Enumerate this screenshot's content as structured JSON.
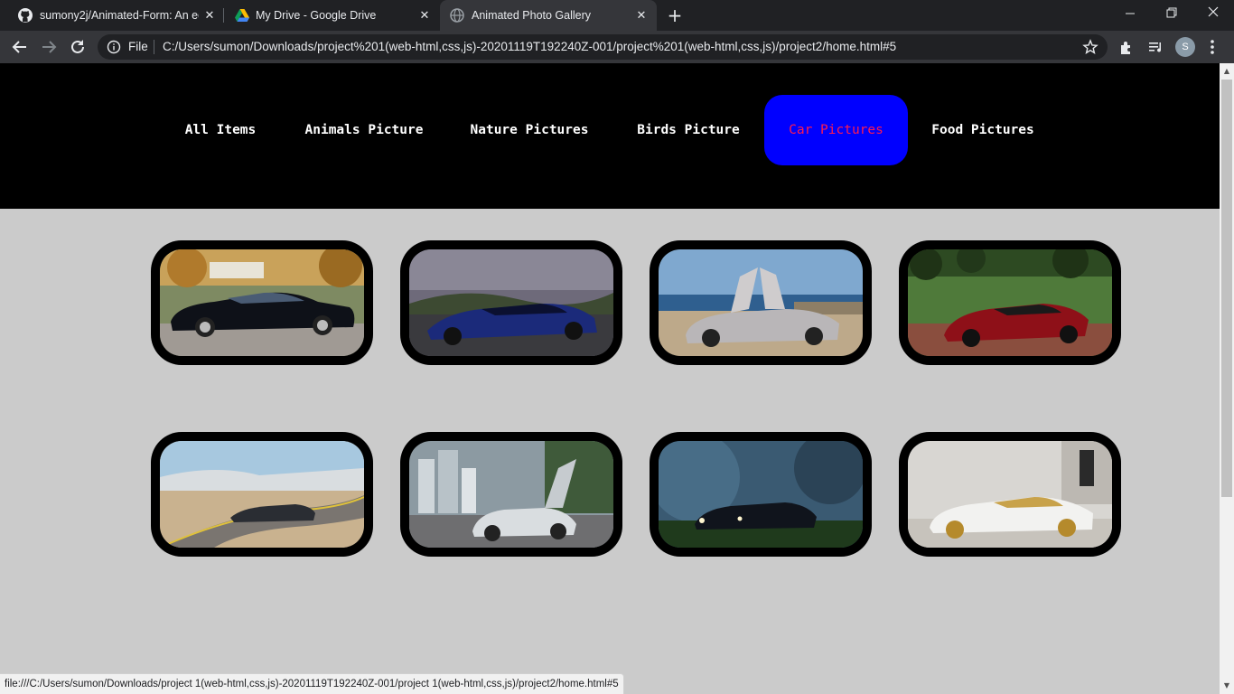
{
  "browser": {
    "tabs": [
      {
        "title": "sumony2j/Animated-Form: An ed",
        "close": "✕",
        "icon": "github-icon",
        "active": false
      },
      {
        "title": "My Drive - Google Drive",
        "close": "✕",
        "icon": "google-drive-icon",
        "active": false
      },
      {
        "title": "Animated Photo Gallery",
        "close": "✕",
        "icon": "globe-icon",
        "active": true
      }
    ],
    "new_tab": "+",
    "window_controls": {
      "minimize": "—",
      "restore": "❐",
      "close": "✕"
    },
    "omnibox": {
      "scheme_label": "File",
      "url": "C:/Users/sumon/Downloads/project%201(web-html,css,js)-20201119T192240Z-001/project%201(web-html,css,js)/project2/home.html#5"
    },
    "profile_initial": "S"
  },
  "gallery": {
    "nav": [
      {
        "label": "All Items",
        "active": false
      },
      {
        "label": "Animals Picture",
        "active": false
      },
      {
        "label": "Nature Pictures",
        "active": false
      },
      {
        "label": "Birds Picture",
        "active": false
      },
      {
        "label": "Car Pictures",
        "active": true
      },
      {
        "label": "Food Pictures",
        "active": false
      }
    ],
    "active_color": "#0000ff",
    "active_text_color": "#ff1a4f",
    "photos": [
      {
        "subject": "black luxury coupe in autumn park"
      },
      {
        "subject": "blue sports car on mountain road"
      },
      {
        "subject": "silver supercar with gullwing doors by the sea"
      },
      {
        "subject": "red supercar on brick driveway"
      },
      {
        "subject": "dark sedan on winding desert road"
      },
      {
        "subject": "silver concept car with open doors in city"
      },
      {
        "subject": "black sedan in misty forest"
      },
      {
        "subject": "white and gold luxury coupe"
      }
    ]
  },
  "status_bar": {
    "text": "file:///C:/Users/sumon/Downloads/project 1(web-html,css,js)-20201119T192240Z-001/project 1(web-html,css,js)/project2/home.html#5"
  }
}
